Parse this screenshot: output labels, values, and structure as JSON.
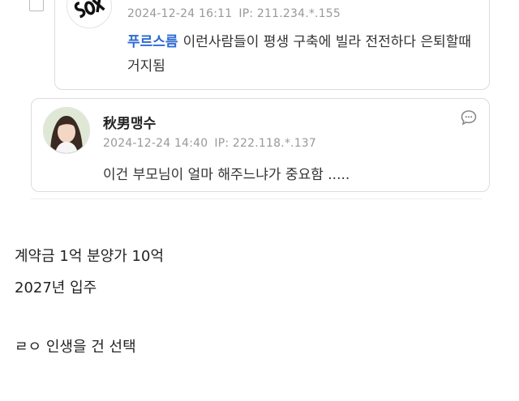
{
  "comments": [
    {
      "date": "2024-12-24 16:11",
      "ip": "IP: 211.234.*.155",
      "mention": "푸르스름",
      "text": "이런사람들이 평생 구축에 빌라 전전하다 은퇴할때 거지됨"
    },
    {
      "author": "秋男맹수",
      "date": "2024-12-24 14:40",
      "ip": "IP: 222.118.*.137",
      "text": "이건 부모님이 얼마 해주느냐가 중요함 .....",
      "reply_icon": "comment-bubble-icon"
    }
  ],
  "post": {
    "lines": [
      "계약금 1억 분양가 10억",
      "2027년 입주",
      "ㄹㅇ 인생을 건 선택"
    ]
  }
}
